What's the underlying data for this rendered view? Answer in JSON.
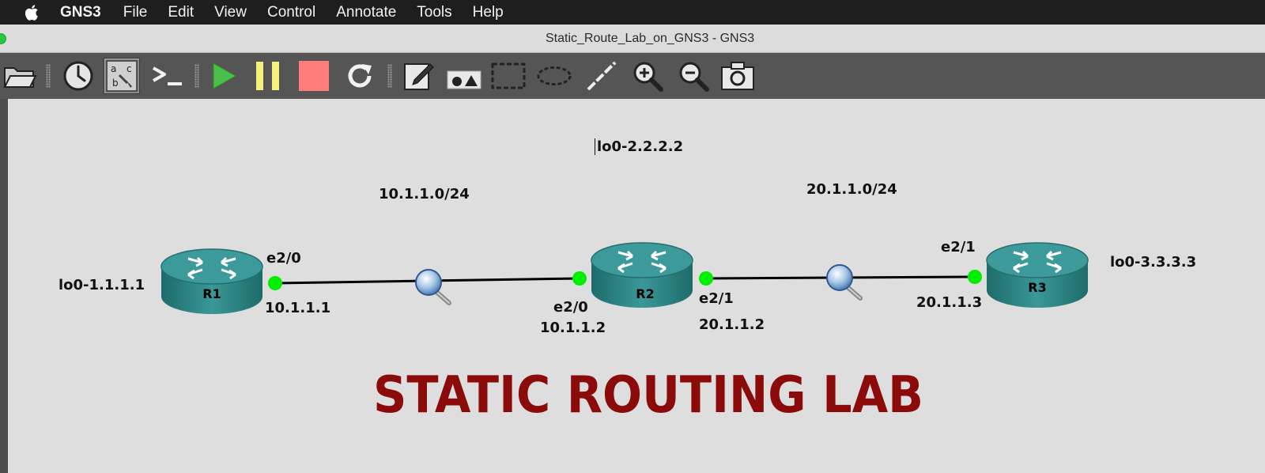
{
  "menubar": {
    "app_name": "GNS3",
    "items": [
      "File",
      "Edit",
      "View",
      "Control",
      "Annotate",
      "Tools",
      "Help"
    ]
  },
  "window": {
    "title": "Static_Route_Lab_on_GNS3 - GNS3"
  },
  "toolbar": {
    "buttons": [
      {
        "name": "open-project",
        "icon": "folder-icon"
      },
      {
        "name": "snapshot",
        "icon": "clock-icon"
      },
      {
        "name": "show-interface-labels",
        "icon": "interface-labels-icon",
        "active": true
      },
      {
        "name": "console-all",
        "icon": "console-icon"
      },
      {
        "name": "start-all",
        "icon": "play-icon"
      },
      {
        "name": "suspend-all",
        "icon": "pause-icon"
      },
      {
        "name": "stop-all",
        "icon": "stop-icon"
      },
      {
        "name": "reload-all",
        "icon": "reload-icon"
      },
      {
        "name": "add-note",
        "icon": "note-icon"
      },
      {
        "name": "insert-picture",
        "icon": "picture-icon"
      },
      {
        "name": "draw-rectangle",
        "icon": "rectangle-icon"
      },
      {
        "name": "draw-ellipse",
        "icon": "ellipse-icon"
      },
      {
        "name": "draw-line",
        "icon": "line-icon"
      },
      {
        "name": "zoom-in",
        "icon": "zoom-in-icon"
      },
      {
        "name": "zoom-out",
        "icon": "zoom-out-icon"
      },
      {
        "name": "screenshot",
        "icon": "camera-icon"
      }
    ]
  },
  "colors": {
    "link_endpoint": "#00ee00",
    "router_body": "#2f8a8a",
    "banner": "#8b0a0a",
    "toolbar_bg": "#555555",
    "canvas_bg": "#dedede"
  },
  "topology": {
    "routers": [
      {
        "name": "R1",
        "loopback": "lo0-1.1.1.1"
      },
      {
        "name": "R2",
        "loopback": "lo0-2.2.2.2"
      },
      {
        "name": "R3",
        "loopback": "lo0-3.3.3.3"
      }
    ],
    "networks": [
      "10.1.1.0/24",
      "20.1.1.0/24"
    ],
    "interfaces": {
      "r1_e2_0": {
        "name": "e2/0",
        "ip": "10.1.1.1"
      },
      "r2_e2_0": {
        "name": "e2/0",
        "ip": "10.1.1.2"
      },
      "r2_e2_1": {
        "name": "e2/1",
        "ip": "20.1.1.2"
      },
      "r3_e2_1": {
        "name": "e2/1",
        "ip": "20.1.1.3"
      }
    }
  },
  "banner": "STATIC ROUTING LAB"
}
